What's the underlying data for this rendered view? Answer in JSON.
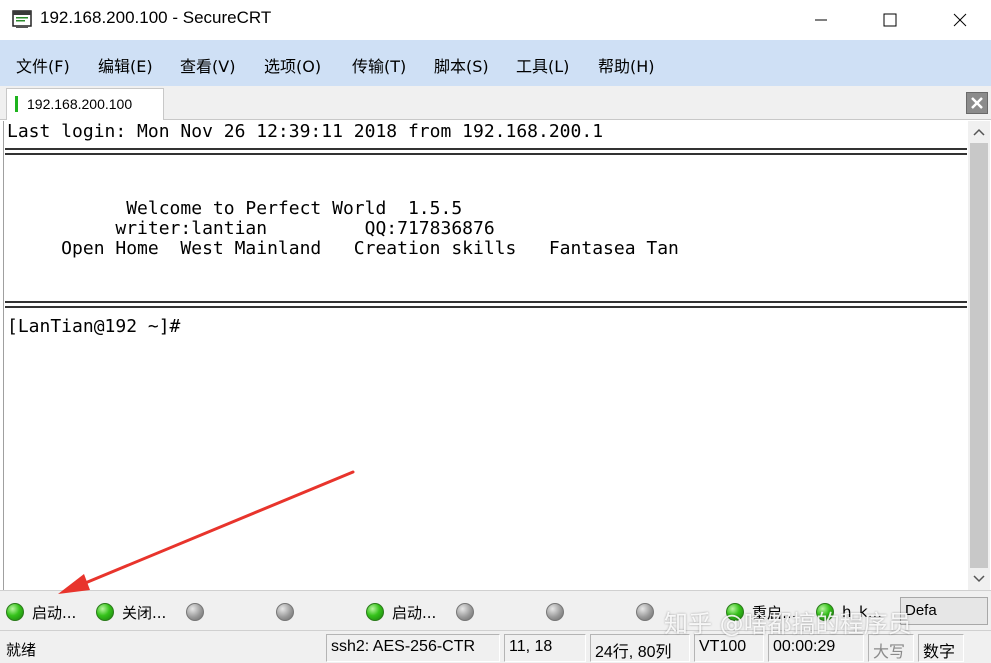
{
  "window": {
    "title": "192.168.200.100 - SecureCRT",
    "icon": "securecrt-app-icon"
  },
  "menu": [
    {
      "label": "文件(F)"
    },
    {
      "label": "编辑(E)"
    },
    {
      "label": "查看(V)"
    },
    {
      "label": "选项(O)"
    },
    {
      "label": "传输(T)"
    },
    {
      "label": "脚本(S)"
    },
    {
      "label": "工具(L)"
    },
    {
      "label": "帮助(H)"
    }
  ],
  "tab": {
    "label": "192.168.200.100",
    "status_color": "#1eb41e"
  },
  "terminal": {
    "lines": [
      "Last login: Mon Nov 26 12:39:11 2018 from 192.168.200.1",
      "           Welcome to Perfect World  1.5.5",
      "          writer:lantian         QQ:717836876",
      "     Open Home  West Mainland   Creation skills   Fantasea Tan",
      "[LanTian@192 ~]#"
    ],
    "separator": "====================================================================================="
  },
  "button_bar": {
    "buttons": [
      {
        "label": "启动...",
        "led": "green"
      },
      {
        "label": "关闭...",
        "led": "green"
      },
      {
        "label": "",
        "led": "gray"
      },
      {
        "label": "",
        "led": "gray"
      },
      {
        "label": "启动...",
        "led": "green"
      },
      {
        "label": "",
        "led": "gray"
      },
      {
        "label": "",
        "led": "gray"
      },
      {
        "label": "",
        "led": "gray"
      },
      {
        "label": "重启...",
        "led": "green"
      },
      {
        "label": "h_k...",
        "led": "green"
      }
    ],
    "dropdown_label": "Defa"
  },
  "status_bar": {
    "ready": "就绪",
    "cipher": "ssh2: AES-256-CTR",
    "cursor_pos": "11,  18",
    "size": "24行, 80列",
    "emulation": "VT100",
    "elapsed": "00:00:29",
    "caps": "大写",
    "num": "数字"
  },
  "watermark": "知乎 @啥都搞的程序员",
  "colors": {
    "menubar": "#cfe0f5",
    "arrow": "#e8342c"
  }
}
